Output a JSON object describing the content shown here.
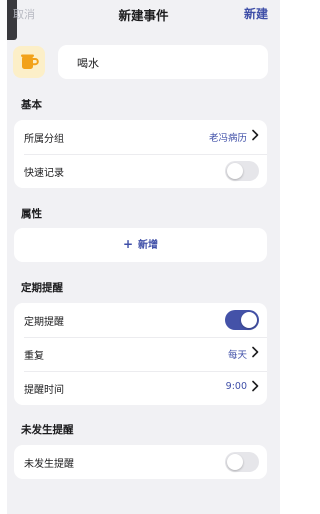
{
  "nav": {
    "cancel": "取消",
    "title": "新建事件",
    "create": "新建"
  },
  "event": {
    "icon": "coffee-cup-icon",
    "name": "喝水"
  },
  "sections": {
    "basic": {
      "title": "基本",
      "group_label": "所属分组",
      "group_value": "老冯病历",
      "quick_record_label": "快速记录",
      "quick_record_on": false
    },
    "attributes": {
      "title": "属性",
      "add_label": "新增"
    },
    "periodic": {
      "title": "定期提醒",
      "toggle_label": "定期提醒",
      "toggle_on": true,
      "repeat_label": "重复",
      "repeat_value": "每天",
      "time_label": "提醒时间",
      "time_value": "9:00"
    },
    "not_occurred": {
      "title": "未发生提醒",
      "toggle_label": "未发生提醒",
      "toggle_on": false
    }
  },
  "colors": {
    "accent": "#3f4fa8",
    "toggle_on": "#4452a8",
    "icon_bg": "#fcefc8",
    "icon_cup": "#f2a21a"
  }
}
